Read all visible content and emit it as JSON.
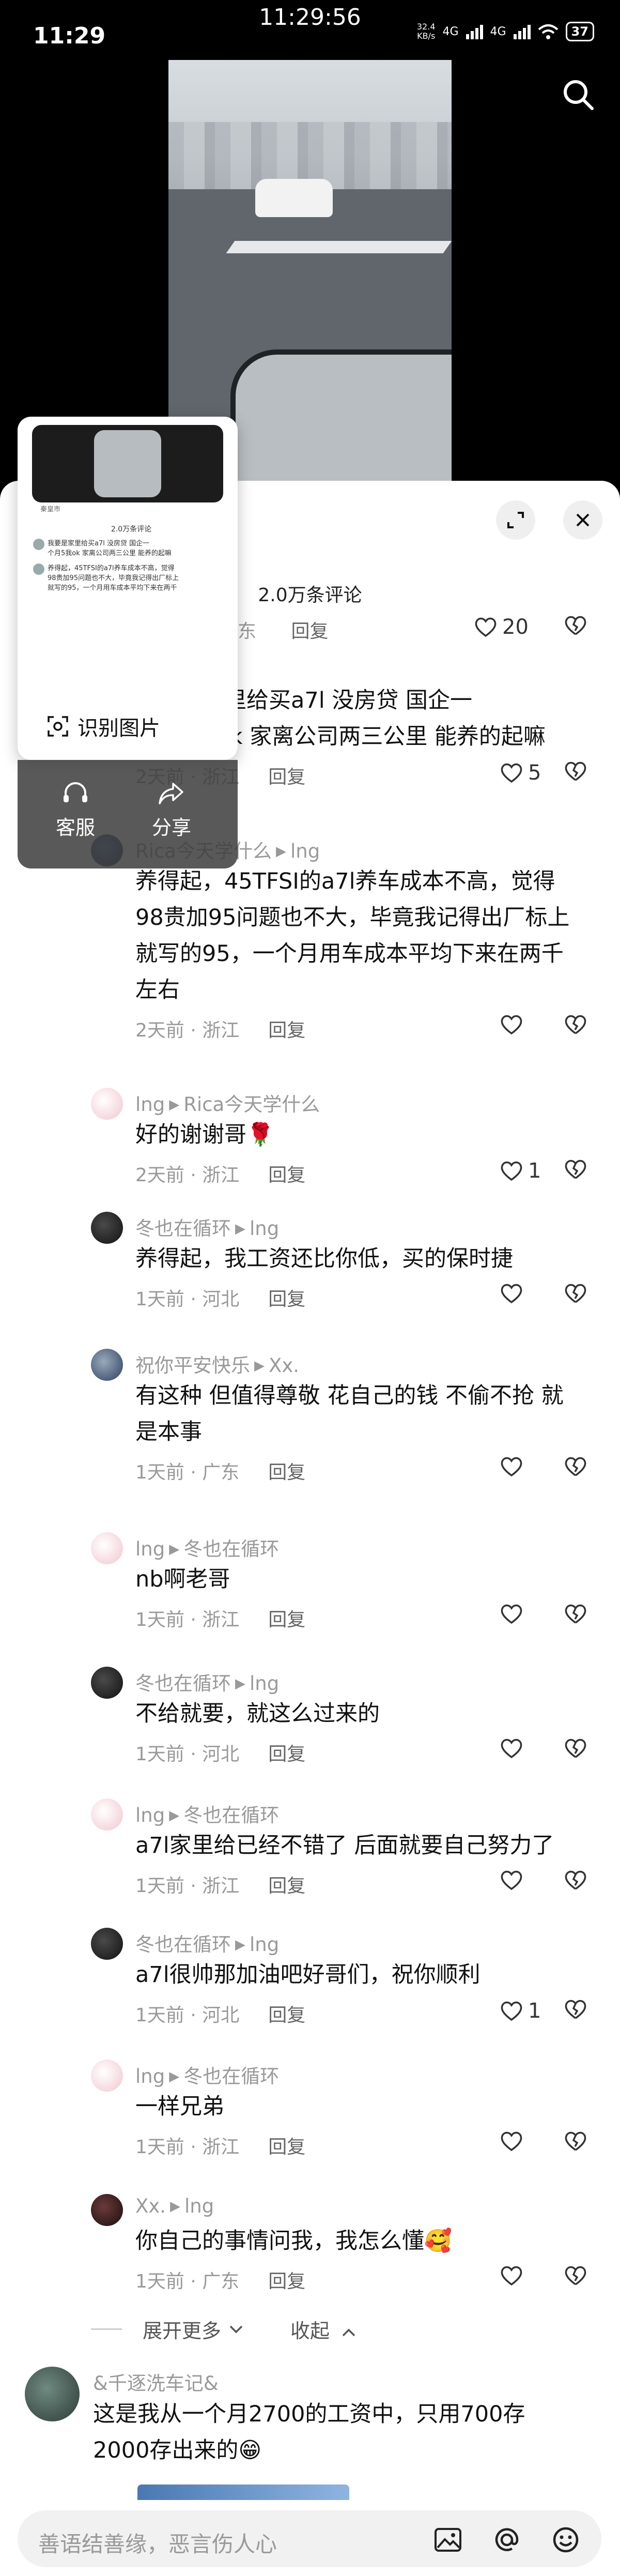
{
  "status_bar": {
    "time": "11:29",
    "center_time": "11:29:56",
    "net_speed": "32.4",
    "net_unit": "KB/s",
    "network_1": "4G",
    "network_2": "4G",
    "battery": "37"
  },
  "sheet": {
    "title": "2.0万条评论"
  },
  "popup": {
    "recognize_label": "识别图片",
    "mini_title": "2.0万条评论",
    "mini_location": "秦皇市",
    "customer_service_label": "客服",
    "share_label": "分享"
  },
  "top_comment": {
    "meta_partial": "东",
    "reply_label": "回复",
    "likes": "20"
  },
  "comments": [
    {
      "text_lines": [
        "我要是家里给买a7l 没房贷 国企一",
        "个月5我ok 家离公司两三公里 能养的起嘛"
      ],
      "time": "2天前",
      "location": "浙江",
      "reply_label": "回复",
      "likes": "5"
    },
    {
      "author": "Rica今天学什么",
      "reply_to": "lng",
      "text_lines": [
        "养得起，45TFSI的a7l养车成本不高，觉得",
        "98贵加95问题也不大，毕竟我记得出厂标上",
        "就写的95，一个月用车成本平均下来在两千",
        "左右"
      ],
      "time": "2天前",
      "location": "浙江",
      "reply_label": "回复",
      "likes": ""
    },
    {
      "author": "lng",
      "reply_to": "Rica今天学什么",
      "text_lines": [
        "好的谢谢哥🌹"
      ],
      "time": "2天前",
      "location": "浙江",
      "reply_label": "回复",
      "likes": "1"
    },
    {
      "author": "冬也在循环",
      "reply_to": "lng",
      "text_lines": [
        "养得起，我工资还比你低，买的保时捷"
      ],
      "time": "1天前",
      "location": "河北",
      "reply_label": "回复",
      "likes": ""
    },
    {
      "author": "祝你平安快乐",
      "reply_to": "Xx.",
      "text_lines": [
        "有这种 但值得尊敬 花自己的钱 不偷不抢 就",
        "是本事"
      ],
      "time": "1天前",
      "location": "广东",
      "reply_label": "回复",
      "likes": ""
    },
    {
      "author": "lng",
      "reply_to": "冬也在循环",
      "text_lines": [
        "nb啊老哥"
      ],
      "time": "1天前",
      "location": "浙江",
      "reply_label": "回复",
      "likes": ""
    },
    {
      "author": "冬也在循环",
      "reply_to": "lng",
      "text_lines": [
        "不给就要，就这么过来的"
      ],
      "time": "1天前",
      "location": "河北",
      "reply_label": "回复",
      "likes": ""
    },
    {
      "author": "lng",
      "reply_to": "冬也在循环",
      "text_lines": [
        "a7l家里给已经不错了 后面就要自己努力了"
      ],
      "time": "1天前",
      "location": "浙江",
      "reply_label": "回复",
      "likes": ""
    },
    {
      "author": "冬也在循环",
      "reply_to": "lng",
      "text_lines": [
        "a7l很帅那加油吧好哥们，祝你顺利"
      ],
      "time": "1天前",
      "location": "河北",
      "reply_label": "回复",
      "likes": "1"
    },
    {
      "author": "lng",
      "reply_to": "冬也在循环",
      "text_lines": [
        "一样兄弟"
      ],
      "time": "1天前",
      "location": "浙江",
      "reply_label": "回复",
      "likes": ""
    },
    {
      "author": "Xx.",
      "reply_to": "lng",
      "text_lines": [
        "你自己的事情问我，我怎么懂🥰"
      ],
      "time": "1天前",
      "location": "广东",
      "reply_label": "回复",
      "likes": ""
    }
  ],
  "thread_controls": {
    "expand_more": "展开更多",
    "collapse": "收起"
  },
  "next_comment": {
    "author": "&千逐洗车记&",
    "text_lines": [
      "这是我从一个月2700的工资中，只用700存",
      "2000存出来的😁"
    ]
  },
  "input": {
    "placeholder": "善语结善缘，恶言伤人心"
  },
  "icons": {
    "like": "heart-outline-icon",
    "dislike": "broken-heart-icon",
    "search": "search-icon",
    "close": "close-icon",
    "expand": "expand-icon",
    "image": "image-icon",
    "mention": "at-icon",
    "emoji": "emoji-icon"
  }
}
